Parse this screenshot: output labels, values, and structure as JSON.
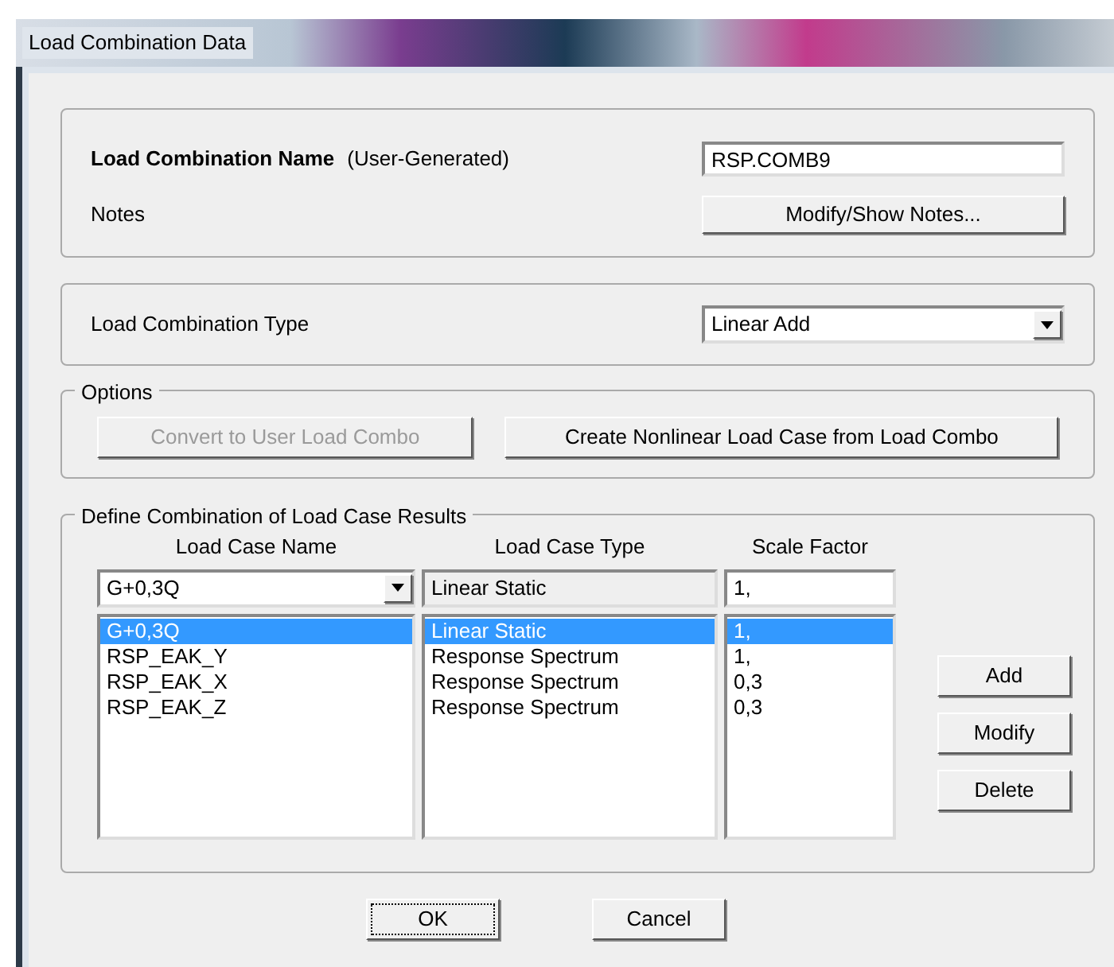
{
  "window": {
    "title": "Load Combination Data"
  },
  "name_panel": {
    "label": "Load Combination Name",
    "hint": "(User-Generated)",
    "value": "RSP.COMB9",
    "notes_label": "Notes",
    "notes_button": "Modify/Show Notes..."
  },
  "type_panel": {
    "label": "Load Combination Type",
    "value": "Linear Add"
  },
  "options": {
    "title": "Options",
    "buttons": [
      {
        "label": "Convert to User Load Combo",
        "disabled": true
      },
      {
        "label": "Create Nonlinear Load Case from Load Combo",
        "disabled": false
      }
    ]
  },
  "define": {
    "title": "Define Combination of Load Case Results",
    "columns": [
      "Load Case Name",
      "Load Case Type",
      "Scale Factor"
    ],
    "inputs": {
      "name": "G+0,3Q",
      "type": "Linear Static",
      "factor": "1,"
    },
    "rows": [
      {
        "name": "G+0,3Q",
        "type": "Linear Static",
        "factor": "1,",
        "selected": true
      },
      {
        "name": "RSP_EAK_Y",
        "type": "Response Spectrum",
        "factor": "1,",
        "selected": false
      },
      {
        "name": "RSP_EAK_X",
        "type": "Response Spectrum",
        "factor": "0,3",
        "selected": false
      },
      {
        "name": "RSP_EAK_Z",
        "type": "Response Spectrum",
        "factor": "0,3",
        "selected": false
      }
    ],
    "buttons": [
      "Add",
      "Modify",
      "Delete"
    ]
  },
  "footer": [
    {
      "label": "OK",
      "focused": true
    },
    {
      "label": "Cancel",
      "focused": false
    }
  ]
}
